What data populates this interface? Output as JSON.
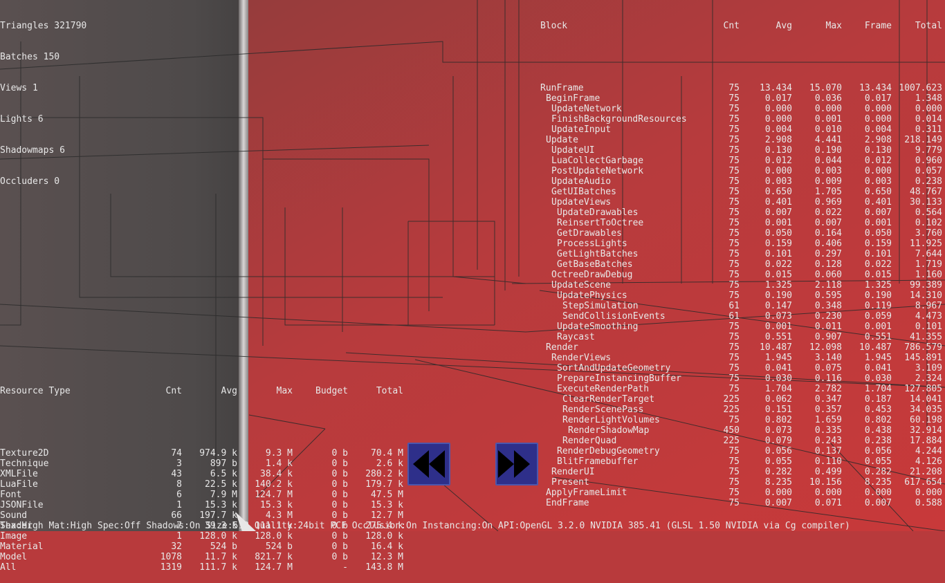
{
  "stats": [
    "Triangles 321790",
    "Batches 150",
    "Views 1",
    "Lights 6",
    "Shadowmaps 6",
    "Occluders 0"
  ],
  "profiler": {
    "headers": [
      "Block",
      "Cnt",
      "Avg",
      "Max",
      "Frame",
      "Total"
    ],
    "rows": [
      {
        "name": "RunFrame",
        "depth": 0,
        "cnt": "75",
        "avg": "13.434",
        "max": "15.070",
        "frame": "13.434",
        "total": "1007.623"
      },
      {
        "name": "BeginFrame",
        "depth": 1,
        "cnt": "75",
        "avg": "0.017",
        "max": "0.036",
        "frame": "0.017",
        "total": "1.348"
      },
      {
        "name": "UpdateNetwork",
        "depth": 2,
        "cnt": "75",
        "avg": "0.000",
        "max": "0.000",
        "frame": "0.000",
        "total": "0.000"
      },
      {
        "name": "FinishBackgroundResources",
        "depth": 2,
        "cnt": "75",
        "avg": "0.000",
        "max": "0.001",
        "frame": "0.000",
        "total": "0.014"
      },
      {
        "name": "UpdateInput",
        "depth": 2,
        "cnt": "75",
        "avg": "0.004",
        "max": "0.010",
        "frame": "0.004",
        "total": "0.311"
      },
      {
        "name": "Update",
        "depth": 1,
        "cnt": "75",
        "avg": "2.908",
        "max": "4.441",
        "frame": "2.908",
        "total": "218.149"
      },
      {
        "name": "UpdateUI",
        "depth": 2,
        "cnt": "75",
        "avg": "0.130",
        "max": "0.190",
        "frame": "0.130",
        "total": "9.779"
      },
      {
        "name": "LuaCollectGarbage",
        "depth": 2,
        "cnt": "75",
        "avg": "0.012",
        "max": "0.044",
        "frame": "0.012",
        "total": "0.960"
      },
      {
        "name": "PostUpdateNetwork",
        "depth": 2,
        "cnt": "75",
        "avg": "0.000",
        "max": "0.003",
        "frame": "0.000",
        "total": "0.057"
      },
      {
        "name": "UpdateAudio",
        "depth": 2,
        "cnt": "75",
        "avg": "0.003",
        "max": "0.009",
        "frame": "0.003",
        "total": "0.238"
      },
      {
        "name": "GetUIBatches",
        "depth": 2,
        "cnt": "75",
        "avg": "0.650",
        "max": "1.705",
        "frame": "0.650",
        "total": "48.767"
      },
      {
        "name": "UpdateViews",
        "depth": 2,
        "cnt": "75",
        "avg": "0.401",
        "max": "0.969",
        "frame": "0.401",
        "total": "30.133"
      },
      {
        "name": "UpdateDrawables",
        "depth": 3,
        "cnt": "75",
        "avg": "0.007",
        "max": "0.022",
        "frame": "0.007",
        "total": "0.564"
      },
      {
        "name": "ReinsertToOctree",
        "depth": 3,
        "cnt": "75",
        "avg": "0.001",
        "max": "0.007",
        "frame": "0.001",
        "total": "0.102"
      },
      {
        "name": "GetDrawables",
        "depth": 3,
        "cnt": "75",
        "avg": "0.050",
        "max": "0.164",
        "frame": "0.050",
        "total": "3.760"
      },
      {
        "name": "ProcessLights",
        "depth": 3,
        "cnt": "75",
        "avg": "0.159",
        "max": "0.406",
        "frame": "0.159",
        "total": "11.925"
      },
      {
        "name": "GetLightBatches",
        "depth": 3,
        "cnt": "75",
        "avg": "0.101",
        "max": "0.297",
        "frame": "0.101",
        "total": "7.644"
      },
      {
        "name": "GetBaseBatches",
        "depth": 3,
        "cnt": "75",
        "avg": "0.022",
        "max": "0.128",
        "frame": "0.022",
        "total": "1.719"
      },
      {
        "name": "OctreeDrawDebug",
        "depth": 2,
        "cnt": "75",
        "avg": "0.015",
        "max": "0.060",
        "frame": "0.015",
        "total": "1.160"
      },
      {
        "name": "UpdateScene",
        "depth": 2,
        "cnt": "75",
        "avg": "1.325",
        "max": "2.118",
        "frame": "1.325",
        "total": "99.389"
      },
      {
        "name": "UpdatePhysics",
        "depth": 3,
        "cnt": "75",
        "avg": "0.190",
        "max": "0.595",
        "frame": "0.190",
        "total": "14.310"
      },
      {
        "name": "StepSimulation",
        "depth": 4,
        "cnt": "61",
        "avg": "0.147",
        "max": "0.348",
        "frame": "0.119",
        "total": "8.967"
      },
      {
        "name": "SendCollisionEvents",
        "depth": 4,
        "cnt": "61",
        "avg": "0.073",
        "max": "0.230",
        "frame": "0.059",
        "total": "4.473"
      },
      {
        "name": "UpdateSmoothing",
        "depth": 3,
        "cnt": "75",
        "avg": "0.001",
        "max": "0.011",
        "frame": "0.001",
        "total": "0.101"
      },
      {
        "name": "Raycast",
        "depth": 3,
        "cnt": "75",
        "avg": "0.551",
        "max": "0.907",
        "frame": "0.551",
        "total": "41.355"
      },
      {
        "name": "Render",
        "depth": 1,
        "cnt": "75",
        "avg": "10.487",
        "max": "12.098",
        "frame": "10.487",
        "total": "786.579"
      },
      {
        "name": "RenderViews",
        "depth": 2,
        "cnt": "75",
        "avg": "1.945",
        "max": "3.140",
        "frame": "1.945",
        "total": "145.891"
      },
      {
        "name": "SortAndUpdateGeometry",
        "depth": 3,
        "cnt": "75",
        "avg": "0.041",
        "max": "0.075",
        "frame": "0.041",
        "total": "3.109"
      },
      {
        "name": "PrepareInstancingBuffer",
        "depth": 3,
        "cnt": "75",
        "avg": "0.030",
        "max": "0.116",
        "frame": "0.030",
        "total": "2.324"
      },
      {
        "name": "ExecuteRenderPath",
        "depth": 3,
        "cnt": "75",
        "avg": "1.704",
        "max": "2.782",
        "frame": "1.704",
        "total": "127.805"
      },
      {
        "name": "ClearRenderTarget",
        "depth": 4,
        "cnt": "225",
        "avg": "0.062",
        "max": "0.347",
        "frame": "0.187",
        "total": "14.041"
      },
      {
        "name": "RenderScenePass",
        "depth": 4,
        "cnt": "225",
        "avg": "0.151",
        "max": "0.357",
        "frame": "0.453",
        "total": "34.035"
      },
      {
        "name": "RenderLightVolumes",
        "depth": 4,
        "cnt": "75",
        "avg": "0.802",
        "max": "1.659",
        "frame": "0.802",
        "total": "60.198"
      },
      {
        "name": "RenderShadowMap",
        "depth": 5,
        "cnt": "450",
        "avg": "0.073",
        "max": "0.335",
        "frame": "0.438",
        "total": "32.914"
      },
      {
        "name": "RenderQuad",
        "depth": 4,
        "cnt": "225",
        "avg": "0.079",
        "max": "0.243",
        "frame": "0.238",
        "total": "17.884"
      },
      {
        "name": "RenderDebugGeometry",
        "depth": 3,
        "cnt": "75",
        "avg": "0.056",
        "max": "0.137",
        "frame": "0.056",
        "total": "4.244"
      },
      {
        "name": "BlitFramebuffer",
        "depth": 3,
        "cnt": "75",
        "avg": "0.055",
        "max": "0.110",
        "frame": "0.055",
        "total": "4.126"
      },
      {
        "name": "RenderUI",
        "depth": 2,
        "cnt": "75",
        "avg": "0.282",
        "max": "0.499",
        "frame": "0.282",
        "total": "21.208"
      },
      {
        "name": "Present",
        "depth": 2,
        "cnt": "75",
        "avg": "8.235",
        "max": "10.156",
        "frame": "8.235",
        "total": "617.654"
      },
      {
        "name": "ApplyFrameLimit",
        "depth": 1,
        "cnt": "75",
        "avg": "0.000",
        "max": "0.000",
        "frame": "0.000",
        "total": "0.000"
      },
      {
        "name": "EndFrame",
        "depth": 1,
        "cnt": "75",
        "avg": "0.007",
        "max": "0.071",
        "frame": "0.007",
        "total": "0.588"
      }
    ]
  },
  "resources": {
    "headers": [
      "Resource Type",
      "Cnt",
      "Avg",
      "Max",
      "Budget",
      "Total"
    ],
    "rows": [
      {
        "type": "Texture2D",
        "cnt": "74",
        "avg": "974.9 k",
        "max": "9.3 M",
        "budget": "0 b",
        "total": "70.4 M"
      },
      {
        "type": "Technique",
        "cnt": "3",
        "avg": "897 b",
        "max": "1.4 k",
        "budget": "0 b",
        "total": "2.6 k"
      },
      {
        "type": "XMLFile",
        "cnt": "43",
        "avg": "6.5 k",
        "max": "38.4 k",
        "budget": "0 b",
        "total": "280.2 k"
      },
      {
        "type": "LuaFile",
        "cnt": "8",
        "avg": "22.5 k",
        "max": "140.2 k",
        "budget": "0 b",
        "total": "179.7 k"
      },
      {
        "type": "Font",
        "cnt": "6",
        "avg": "7.9 M",
        "max": "124.7 M",
        "budget": "0 b",
        "total": "47.5 M"
      },
      {
        "type": "JSONFile",
        "cnt": "1",
        "avg": "15.3 k",
        "max": "15.3 k",
        "budget": "0 b",
        "total": "15.3 k"
      },
      {
        "type": "Sound",
        "cnt": "66",
        "avg": "197.7 k",
        "max": "4.3 M",
        "budget": "0 b",
        "total": "12.7 M"
      },
      {
        "type": "Shader",
        "cnt": "7",
        "avg": "39.3 k",
        "max": "111.1 k",
        "budget": "0 b",
        "total": "275.4 k"
      },
      {
        "type": "Image",
        "cnt": "1",
        "avg": "128.0 k",
        "max": "128.0 k",
        "budget": "0 b",
        "total": "128.0 k"
      },
      {
        "type": "Material",
        "cnt": "32",
        "avg": "524 b",
        "max": "524 b",
        "budget": "0 b",
        "total": "16.4 k"
      },
      {
        "type": "Model",
        "cnt": "1078",
        "avg": "11.7 k",
        "max": "821.7 k",
        "budget": "0 b",
        "total": "12.3 M"
      },
      {
        "type": "All",
        "cnt": "1319",
        "avg": "111.7 k",
        "max": "124.7 M",
        "budget": "-",
        "total": "143.8 M"
      }
    ]
  },
  "nav": {
    "prev_icon": "rewind-icon",
    "next_icon": "fast-forward-icon"
  },
  "status_line": "Tex:High Mat:High Spec:Off Shadows:On Size:512 Quality:24bit PCF Occlusion:On Instancing:On API:OpenGL 3.2.0 NVIDIA 385.41 (GLSL 1.50 NVIDIA via Cg compiler)",
  "colors": {
    "background_red": "#b83a3c",
    "wall_gray": "#565050",
    "wireframe": "#2a2a2a",
    "text": "#e8e8e8",
    "button_fill": "#2e2f8a",
    "button_border": "#4c56ad"
  }
}
